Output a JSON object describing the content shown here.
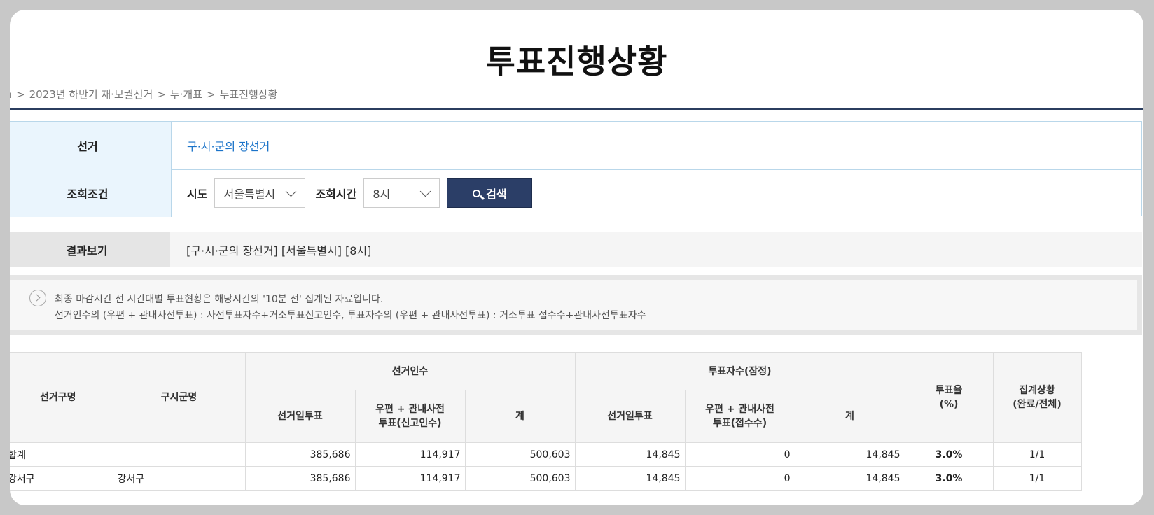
{
  "page_title": "투표진행상황",
  "breadcrumb": {
    "items": [
      "2023년 하반기 재·보궐선거",
      "투·개표",
      "투표진행상황"
    ],
    "separator": ">"
  },
  "search": {
    "election_label": "선거",
    "election_value": "구·시·군의 장선거",
    "condition_label": "조회조건",
    "sido_label": "시도",
    "sido_value": "서울특별시",
    "time_label": "조회시간",
    "time_value": "8시",
    "search_button": "검색"
  },
  "result": {
    "label": "결과보기",
    "value": "[구·시·군의 장선거] [서울특별시] [8시]"
  },
  "notice": {
    "line1": "최종 마감시간 전 시간대별 투표현황은 해당시간의 '10분 전' 집계된 자료입니다.",
    "line2": "선거인수의 (우편 + 관내사전투표) : 사전투표자수+거소투표신고인수, 투표자수의 (우편 + 관내사전투표) : 거소투표 접수수+관내사전투표자수"
  },
  "table": {
    "headers": {
      "district": "선거구명",
      "sigungu": "구시군명",
      "electors": "선거인수",
      "voters": "투표자수(잠정)",
      "rate_l1": "투표율",
      "rate_l2": "(%)",
      "status_l1": "집계상황",
      "status_l2": "(완료/전체)",
      "e_day": "선거일투표",
      "e_mail_l1": "우편 + 관내사전",
      "e_mail_l2": "투표(신고인수)",
      "e_sum": "계",
      "v_day": "선거일투표",
      "v_mail_l1": "우편 + 관내사전",
      "v_mail_l2": "투표(접수수)",
      "v_sum": "계"
    },
    "rows": [
      {
        "district": "합계",
        "sigungu": "",
        "e_day": "385,686",
        "e_mail": "114,917",
        "e_sum": "500,603",
        "v_day": "14,845",
        "v_mail": "0",
        "v_sum": "14,845",
        "rate": "3.0%",
        "status": "1/1"
      },
      {
        "district": "강서구",
        "sigungu": "강서구",
        "e_day": "385,686",
        "e_mail": "114,917",
        "e_sum": "500,603",
        "v_day": "14,845",
        "v_mail": "0",
        "v_sum": "14,845",
        "rate": "3.0%",
        "status": "1/1"
      }
    ]
  },
  "colors": {
    "accent_navy": "#2b3e67",
    "link_blue": "#1a73c9",
    "rate_red": "#e02b20",
    "th_blue_bg": "#eaf5fd"
  }
}
